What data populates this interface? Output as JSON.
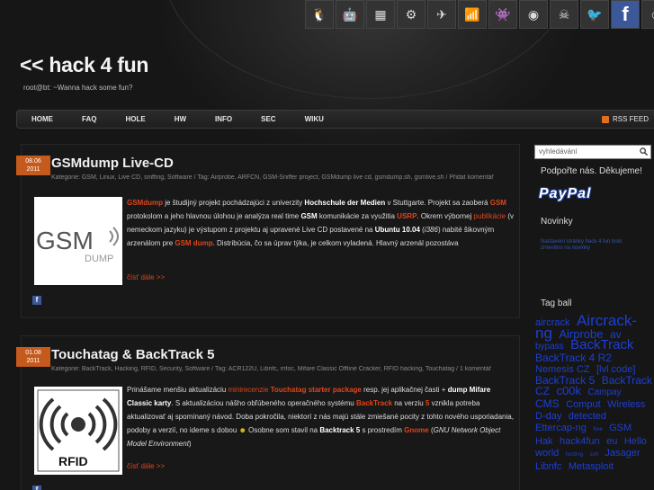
{
  "header": {
    "title": "<< hack 4 fun",
    "tagline": "root@bt: ~Wanna hack some fun?",
    "thumbs": [
      "tux-icon",
      "robot-icon",
      "chip-icon",
      "hardware-icon",
      "gadget-icon",
      "wifi-icon",
      "monster-icon",
      "coin-icon",
      "mask-icon",
      "bird-icon",
      "facebook-icon",
      "avatar-icon"
    ]
  },
  "nav": {
    "items": [
      "HOME",
      "FAQ",
      "HOLE",
      "HW",
      "INFO",
      "SEC",
      "WIKU"
    ],
    "rss": "RSS FEED"
  },
  "posts": [
    {
      "date_day": "08.06",
      "date_year": "2011",
      "title": "GSMdump Live-CD",
      "meta": "Kategorie: GSM, Linux, Live CD, sniffing, Software / Tag: Airprobe, ARFCN, GSM-Sniffer project, GSMdump live cd, gsmdump.sh, gsmlive.sh / Přidat komentář",
      "image_text": "GSM",
      "image_sub": "DUMP",
      "more": "čísť dále >>"
    },
    {
      "date_day": "01.08",
      "date_year": "2011",
      "title": "Touchatag & BackTrack 5",
      "meta": "Kategorie: BackTrack, Hacking, RFID, Security, Software / Tag: ACR122U, Libnfc, mfoc, Mifare Classic Offline Cracker, RFID hacking, Touchatag / 1 komentář",
      "image_text": "RFID",
      "more": "čísť dále >>"
    }
  ],
  "post1_text": {
    "t1": "GSMdump",
    "t2": " je študijný projekt pochádzajúci z univerzity ",
    "t3": "Hochschule der Medien",
    "t4": " v Stuttgarte. Projekt sa zaoberá ",
    "t5": "GSM",
    "t6": " protokolom a jeho hlavnou úlohou je analýza real time ",
    "t7": "GSM",
    "t8": " komunikácie za využitia ",
    "t9": "USRP",
    "t10": ". Okrem výbornej ",
    "t11": "publikácie",
    "t12": " (v nemeckom jazyku) je výstupom z projektu aj upravené Live CD postavené na ",
    "t13": "Ubuntu 10.04",
    "t14": " (",
    "t15": "i386",
    "t16": ") nabité šikovným arzenálom pre ",
    "t17": "GSM dump",
    "t18": ". Distribúcia, čo sa úprav týka, je celkom vyladená. Hlavný arzenál pozostáva"
  },
  "post2_text": {
    "t1": "Prinášame menšiu aktualizáciu ",
    "t2": "minirecenzie",
    "t3": " ",
    "t4": "Touchatag starter package",
    "t5": " resp. jej aplikačnej časti + ",
    "t6": "dump Mifare Classic karty",
    "t7": ". S aktualizáciou nášho obľúbeného operačného systému ",
    "t8": "BackTrack",
    "t9": " na verziu ",
    "t10": "5",
    "t11": " vznikla potreba aktualizovať aj spomínaný návod. Doba pokročila, niektorí z nás majú stále zmiešané pocity z tohto nového usporiadania, podoby a verzií, no ideme s dobou ",
    "t12": "☻",
    "t13": " Osobne som stavil na ",
    "t14": "Backtrack 5",
    "t15": " s prostredím ",
    "t16": "Gnome",
    "t17": " (",
    "t18": "GNU Network Object Model Environment",
    "t19": ")"
  },
  "sidebar": {
    "search_placeholder": "vyhledávání",
    "donate": "Podpořte nás. Děkujeme!",
    "paypal": "PayPal",
    "news_title": "Novinky",
    "news_link": "Nastavení stránky hack 4 fun bolo zmeněno na novinky",
    "tags_title": "Tag ball",
    "tags": [
      {
        "t": "aircrack",
        "s": 11
      },
      {
        "t": "Aircrack-ng",
        "s": 17
      },
      {
        "t": "Airprobe",
        "s": 13
      },
      {
        "t": "av",
        "s": 12
      },
      {
        "t": "bypass",
        "s": 10
      },
      {
        "t": "BackTrack",
        "s": 15
      },
      {
        "t": "BackTrack 4 R2",
        "s": 12
      },
      {
        "t": "Nemesis CZ",
        "s": 11
      },
      {
        "t": "[lvl code]",
        "s": 11
      },
      {
        "t": "BackTrack 5",
        "s": 12
      },
      {
        "t": "BackTrack CZ",
        "s": 12
      },
      {
        "t": "c00k",
        "s": 13
      },
      {
        "t": "Campay",
        "s": 10
      },
      {
        "t": "CMS",
        "s": 12
      },
      {
        "t": "Comput",
        "s": 11
      },
      {
        "t": "Wireless",
        "s": 11
      },
      {
        "t": "D-day",
        "s": 11
      },
      {
        "t": "detected",
        "s": 11
      },
      {
        "t": "Ettercap-ng",
        "s": 11
      },
      {
        "t": "free",
        "s": 6
      },
      {
        "t": "GSM",
        "s": 11
      },
      {
        "t": "Hak",
        "s": 11
      },
      {
        "t": "hack4fun",
        "s": 11
      },
      {
        "t": "eu",
        "s": 11
      },
      {
        "t": "Hello world",
        "s": 11
      },
      {
        "t": "hosting",
        "s": 6
      },
      {
        "t": "ssh",
        "s": 6
      },
      {
        "t": "Jasager",
        "s": 11
      },
      {
        "t": "Libnfc",
        "s": 11
      },
      {
        "t": "Metasploit",
        "s": 11
      }
    ]
  },
  "colors": {
    "accent": "#e0441c",
    "date_badge": "#c55a1d",
    "tag_link": "#1d3fd3",
    "background": "#161616"
  }
}
